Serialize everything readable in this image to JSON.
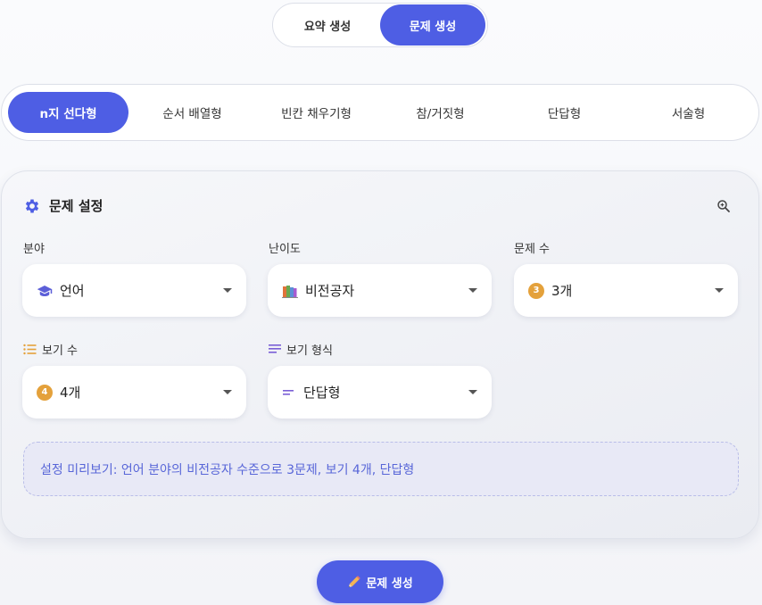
{
  "mode_toggle": {
    "summary_label": "요약 생성",
    "generate_label": "문제 생성",
    "active": "generate"
  },
  "question_types": [
    {
      "label": "n지 선다형",
      "active": true
    },
    {
      "label": "순서 배열형",
      "active": false
    },
    {
      "label": "빈칸 채우기형",
      "active": false
    },
    {
      "label": "참/거짓형",
      "active": false
    },
    {
      "label": "단답형",
      "active": false
    },
    {
      "label": "서술형",
      "active": false
    }
  ],
  "settings": {
    "title": "문제 설정",
    "field_label": "분야",
    "field_value": "언어",
    "difficulty_label": "난이도",
    "difficulty_value": "비전공자",
    "count_label": "문제 수",
    "count_badge": "3",
    "count_value": "3개",
    "options_label": "보기 수",
    "options_badge": "4",
    "options_value": "4개",
    "format_label": "보기 형식",
    "format_value": "단답형",
    "preview_text": "설정 미리보기: 언어 분야의 비전공자 수준으로 3문제, 보기 4개, 단답형"
  },
  "generate_button": "문제 생성",
  "colors": {
    "accent": "#4e5ee4",
    "badge": "#e4a13b",
    "preview_text": "#5866d8"
  }
}
